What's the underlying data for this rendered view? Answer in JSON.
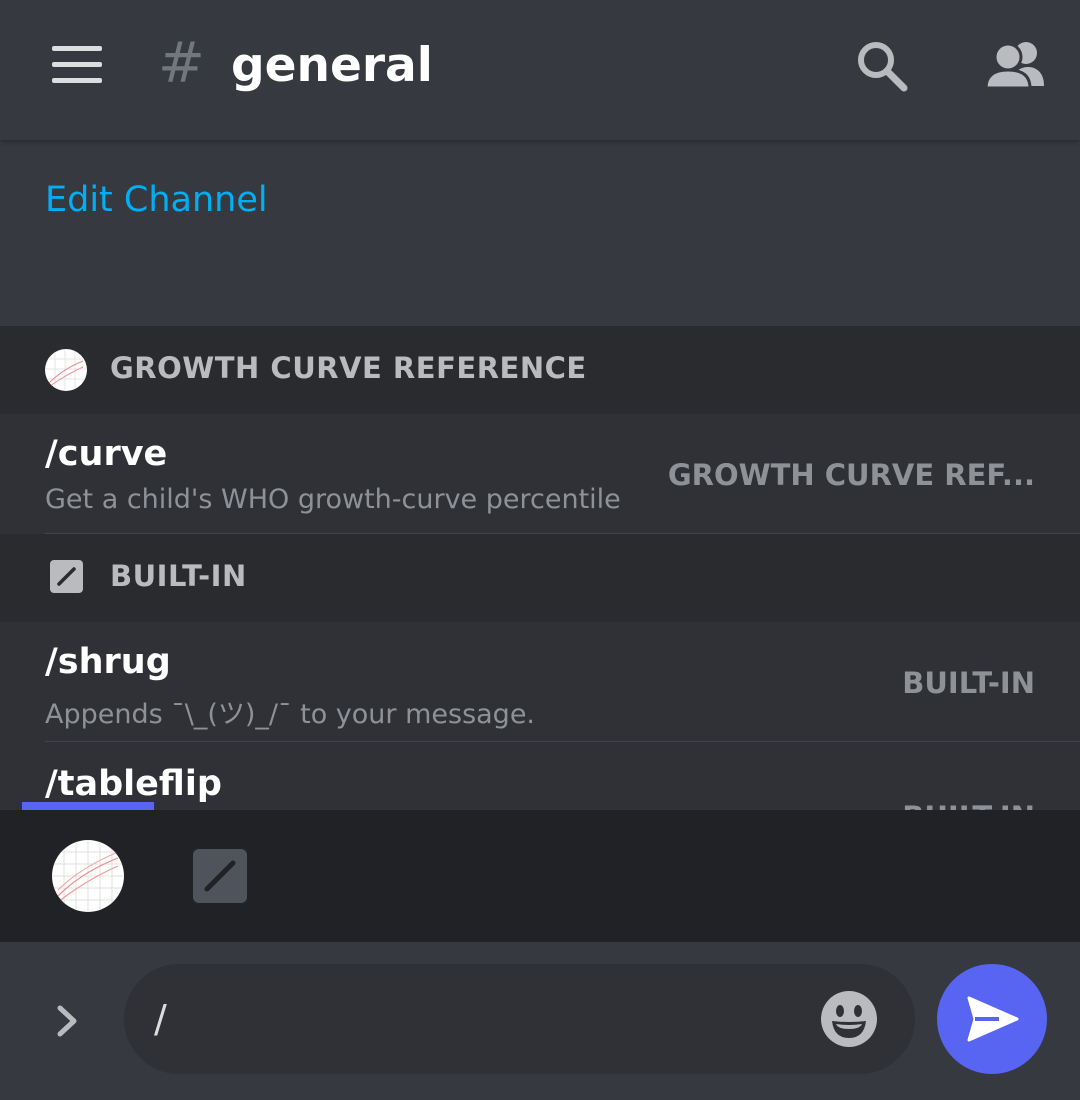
{
  "header": {
    "hash_symbol": "#",
    "channel_name": "general",
    "icons": {
      "menu": "hamburger-menu-icon",
      "search": "search-icon",
      "members": "members-icon"
    }
  },
  "intro": {
    "edit_channel_label": "Edit Channel"
  },
  "autocomplete": {
    "sections": [
      {
        "label": "GROWTH CURVE REFERENCE",
        "icon": "growth-chart-app-icon",
        "commands": [
          {
            "name": "/curve",
            "description": "Get a child's WHO growth-curve percentile",
            "source": "GROWTH CURVE REF..."
          }
        ]
      },
      {
        "label": "BUILT-IN",
        "icon": "slash-command-icon",
        "commands": [
          {
            "name": "/shrug",
            "description": "Appends ¯\\_(ツ)_/¯ to your message.",
            "source": "BUILT-IN"
          },
          {
            "name": "/tableflip",
            "description": "",
            "source": "BUILT-IN"
          }
        ]
      }
    ]
  },
  "app_bar": {
    "apps": [
      {
        "icon": "growth-chart-app-icon",
        "selected": true
      },
      {
        "icon": "slash-command-icon",
        "selected": false
      }
    ]
  },
  "composer": {
    "input_value": "/",
    "icons": {
      "expand": "chevron-right-icon",
      "emoji": "emoji-icon",
      "send": "send-icon"
    }
  },
  "colors": {
    "background": "#36393f",
    "panel": "#2f3136",
    "section_header": "#292b2f",
    "app_bar": "#202225",
    "accent": "#5865f2",
    "link": "#00aff4"
  }
}
